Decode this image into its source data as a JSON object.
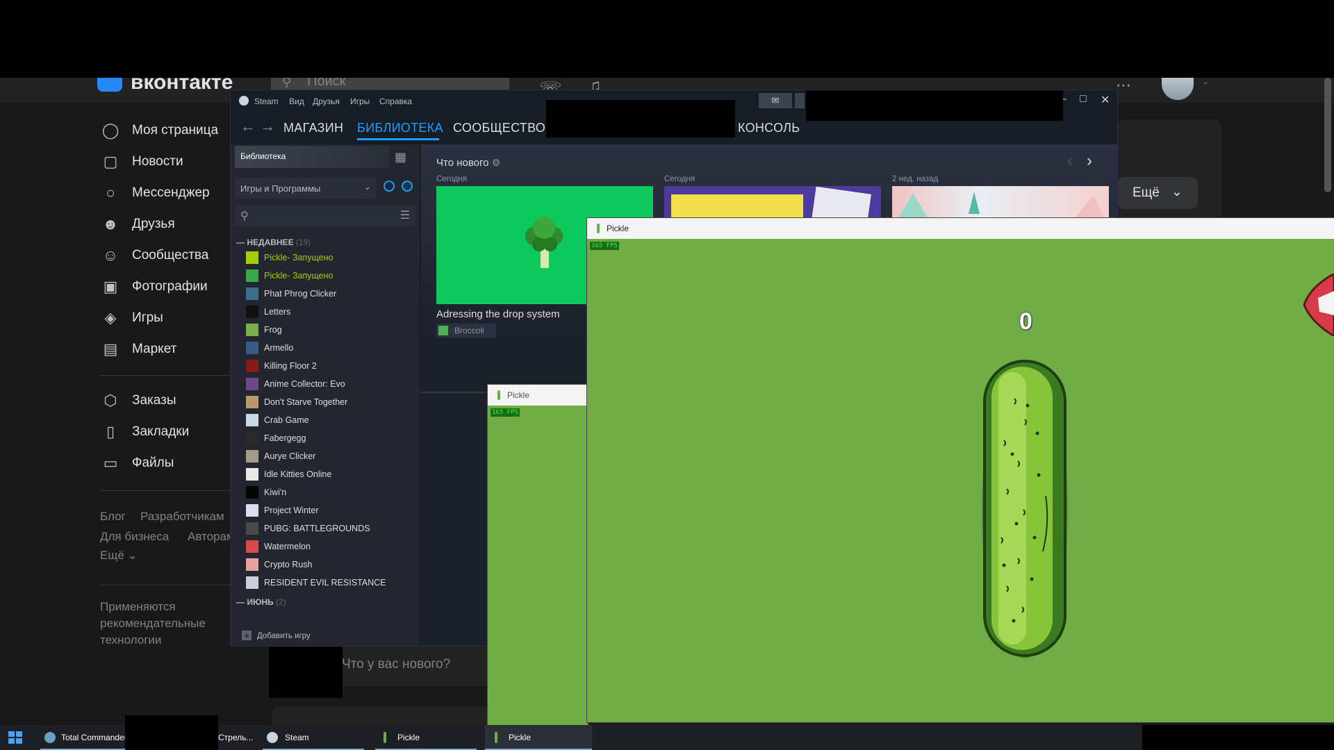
{
  "vk": {
    "brand": "вконтакте",
    "search_placeholder": "Поиск",
    "nav": [
      {
        "label": "Моя страница",
        "icon": "user-circle-icon"
      },
      {
        "label": "Новости",
        "icon": "newspaper-icon"
      },
      {
        "label": "Мессенджер",
        "icon": "chat-bubble-icon"
      },
      {
        "label": "Друзья",
        "icon": "friends-icon"
      },
      {
        "label": "Сообщества",
        "icon": "communities-icon"
      },
      {
        "label": "Фотографии",
        "icon": "photo-icon"
      },
      {
        "label": "Игры",
        "icon": "gamepad-icon"
      },
      {
        "label": "Маркет",
        "icon": "shopping-bag-icon"
      }
    ],
    "nav2": [
      {
        "label": "Заказы",
        "icon": "box-icon"
      },
      {
        "label": "Закладки",
        "icon": "bookmark-icon"
      },
      {
        "label": "Файлы",
        "icon": "file-icon"
      }
    ],
    "footer_links": [
      "Блог",
      "Разработчикам",
      "Для бизнеса",
      "Авторам",
      "Ещё"
    ],
    "recommend_note_1": "Применяются",
    "recommend_note_2": "рекомендательные",
    "recommend_note_3": "технологии",
    "more_button": "Ещё",
    "post_placeholder": "Что у вас нового?"
  },
  "steam": {
    "menu": [
      "Steam",
      "Вид",
      "Друзья",
      "Игры",
      "Справка"
    ],
    "tabs": {
      "store": "МАГАЗИН",
      "library": "БИБЛИОТЕКА",
      "community": "СООБЩЕСТВО",
      "console": "КОНСОЛЬ"
    },
    "library_label": "Библиотека",
    "filter_label": "Игры и Программы",
    "recent_section": "НЕДАВНЕЕ",
    "recent_count": "(19)",
    "june_section": "ИЮНЬ",
    "june_count": "(2)",
    "running_suffix": " - Запущено",
    "games": [
      {
        "name": "Pickle",
        "running": true,
        "color": "#a3cf06"
      },
      {
        "name": "Pickle",
        "running": true,
        "color": "#3aa84a"
      },
      {
        "name": "Phat Phrog Clicker",
        "running": false,
        "color": "#3c6e8a"
      },
      {
        "name": "Letters",
        "running": false,
        "color": "#111111"
      },
      {
        "name": "Frog",
        "running": false,
        "color": "#7cae4a"
      },
      {
        "name": "Armello",
        "running": false,
        "color": "#3a5a8a"
      },
      {
        "name": "Killing Floor 2",
        "running": false,
        "color": "#8a1a1a"
      },
      {
        "name": "Anime Collector: Evo",
        "running": false,
        "color": "#6a4a8a"
      },
      {
        "name": "Don't Starve Together",
        "running": false,
        "color": "#b89a6a"
      },
      {
        "name": "Crab Game",
        "running": false,
        "color": "#c8d8e8"
      },
      {
        "name": "Fabergegg",
        "running": false,
        "color": "#2a2a2a"
      },
      {
        "name": "Aurye Clicker",
        "running": false,
        "color": "#a89a8a"
      },
      {
        "name": "Idle Kitties Online",
        "running": false,
        "color": "#e8e8e8"
      },
      {
        "name": "Kiwi'n",
        "running": false,
        "color": "#050505"
      },
      {
        "name": "Project Winter",
        "running": false,
        "color": "#d8e0f0"
      },
      {
        "name": "PUBG: BATTLEGROUNDS",
        "running": false,
        "color": "#4a4a4a"
      },
      {
        "name": "Watermelon",
        "running": false,
        "color": "#d84a4a"
      },
      {
        "name": "Crypto Rush",
        "running": false,
        "color": "#e8a0a0"
      },
      {
        "name": "RESIDENT EVIL RESISTANCE",
        "running": false,
        "color": "#c8d0d8"
      }
    ],
    "add_game": "Добавить игру",
    "whats_new": "Что нового",
    "news": [
      {
        "when": "Сегодня"
      },
      {
        "when": "Сегодня"
      },
      {
        "when": "2 нед. назад"
      }
    ],
    "card1_title": "Adressing the drop system",
    "card1_tag": "Broccoli"
  },
  "pickle": {
    "window_title": "Pickle",
    "fps": "165 FPS",
    "count": "0"
  },
  "taskbar": {
    "items": [
      "Total Commander",
      "Стрель...",
      "Steam",
      "Pickle",
      "Pickle"
    ]
  }
}
